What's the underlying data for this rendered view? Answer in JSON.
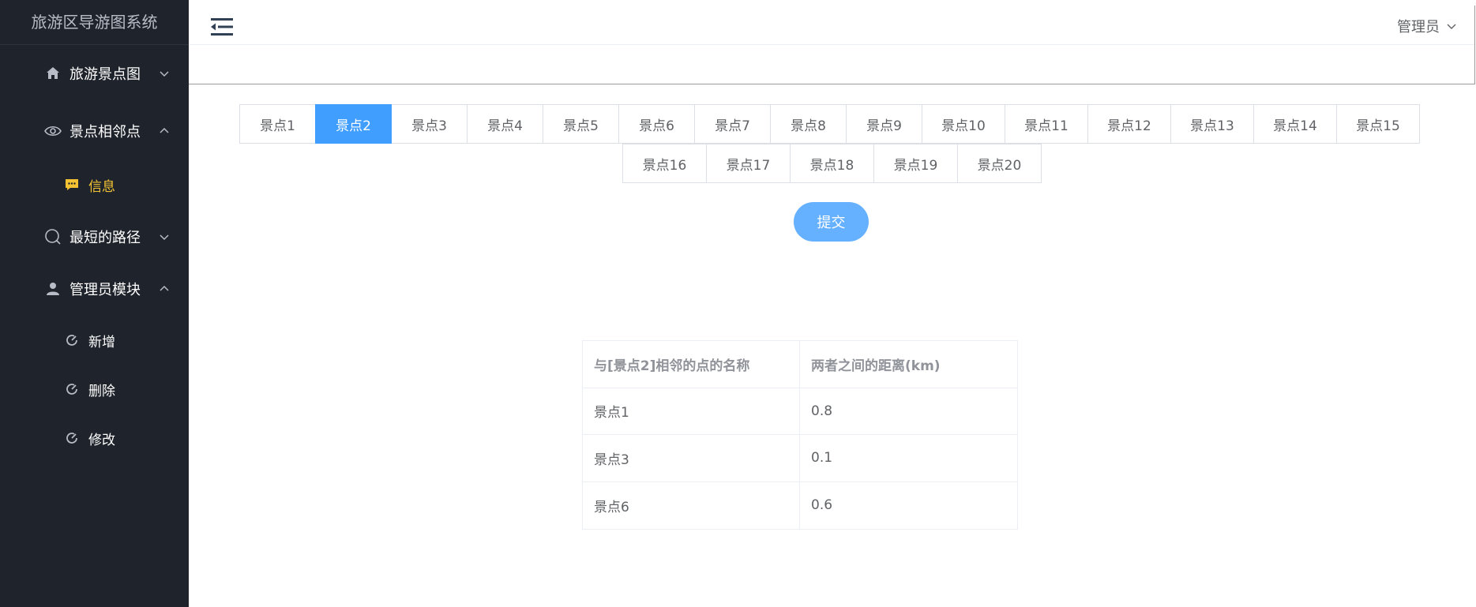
{
  "app": {
    "title": "旅游区导游图系统"
  },
  "sidebar": {
    "items": [
      {
        "label": "旅游景点图",
        "icon": "home-icon"
      },
      {
        "label": "景点相邻点",
        "icon": "eye-icon"
      },
      {
        "label": "信息",
        "icon": "message-icon"
      },
      {
        "label": "最短的路径",
        "icon": "search-icon"
      },
      {
        "label": "管理员模块",
        "icon": "user-icon"
      },
      {
        "label": "新增",
        "icon": "edit-circle-icon"
      },
      {
        "label": "删除",
        "icon": "edit-circle-icon"
      },
      {
        "label": "修改",
        "icon": "edit-circle-icon"
      }
    ],
    "active_color": "#f2c233"
  },
  "header": {
    "user_label": "管理员"
  },
  "tabs": [
    "景点1",
    "景点2",
    "景点3",
    "景点4",
    "景点5",
    "景点6",
    "景点7",
    "景点8",
    "景点9",
    "景点10",
    "景点11",
    "景点12",
    "景点13",
    "景点14",
    "景点15",
    "景点16",
    "景点17",
    "景点18",
    "景点19",
    "景点20"
  ],
  "selected_tab": "景点2",
  "submit_label": "提交",
  "table": {
    "headers": [
      "与[景点2]相邻的点的名称",
      "两者之间的距离(km)"
    ],
    "rows": [
      [
        "景点1",
        "0.8"
      ],
      [
        "景点3",
        "0.1"
      ],
      [
        "景点6",
        "0.6"
      ]
    ]
  },
  "colors": {
    "primary": "#409eff",
    "sidebar_bg": "#1f232b"
  }
}
